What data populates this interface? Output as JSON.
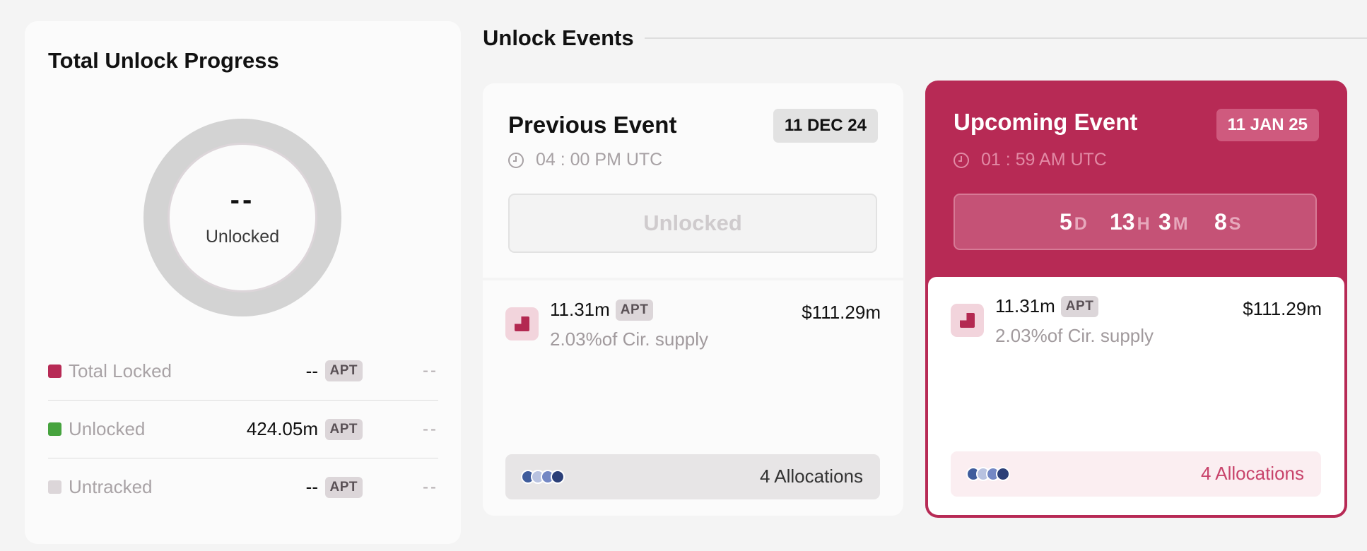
{
  "total_unlock": {
    "title": "Total Unlock Progress",
    "donut_value": "--",
    "donut_label": "Unlocked",
    "legend": [
      {
        "name": "Total Locked",
        "amount": "--",
        "token": "APT",
        "pct": "--",
        "color": "#b72a55"
      },
      {
        "name": "Unlocked",
        "amount": "424.05m",
        "token": "APT",
        "pct": "--",
        "color": "#46a33e"
      },
      {
        "name": "Untracked",
        "amount": "--",
        "token": "APT",
        "pct": "--",
        "color": "#dcd6d9"
      }
    ]
  },
  "unlock_events": {
    "title": "Unlock Events",
    "previous": {
      "title": "Previous Event",
      "date": "11 DEC 24",
      "time": "04 : 00 PM UTC",
      "status": "Unlocked",
      "amount": "11.31m",
      "token": "APT",
      "supply": "2.03%of Cir. supply",
      "usd": "$111.29m",
      "allocations": "4  Allocations"
    },
    "upcoming": {
      "title": "Upcoming Event",
      "date": "11 JAN 25",
      "time": "01 : 59 AM UTC",
      "countdown": {
        "days": "5",
        "days_unit": "D",
        "hours": "13",
        "hours_unit": "H",
        "minutes": "3",
        "minutes_unit": "M",
        "seconds": "8",
        "seconds_unit": "S"
      },
      "amount": "11.31m",
      "token": "APT",
      "supply": "2.03%of Cir. supply",
      "usd": "$111.29m",
      "allocations": "4  Allocations"
    }
  },
  "colors": {
    "accent": "#b72a55",
    "dot_colors": [
      "#3f5c9c",
      "#b8c2e0",
      "#7387c4",
      "#2b3f78"
    ]
  }
}
